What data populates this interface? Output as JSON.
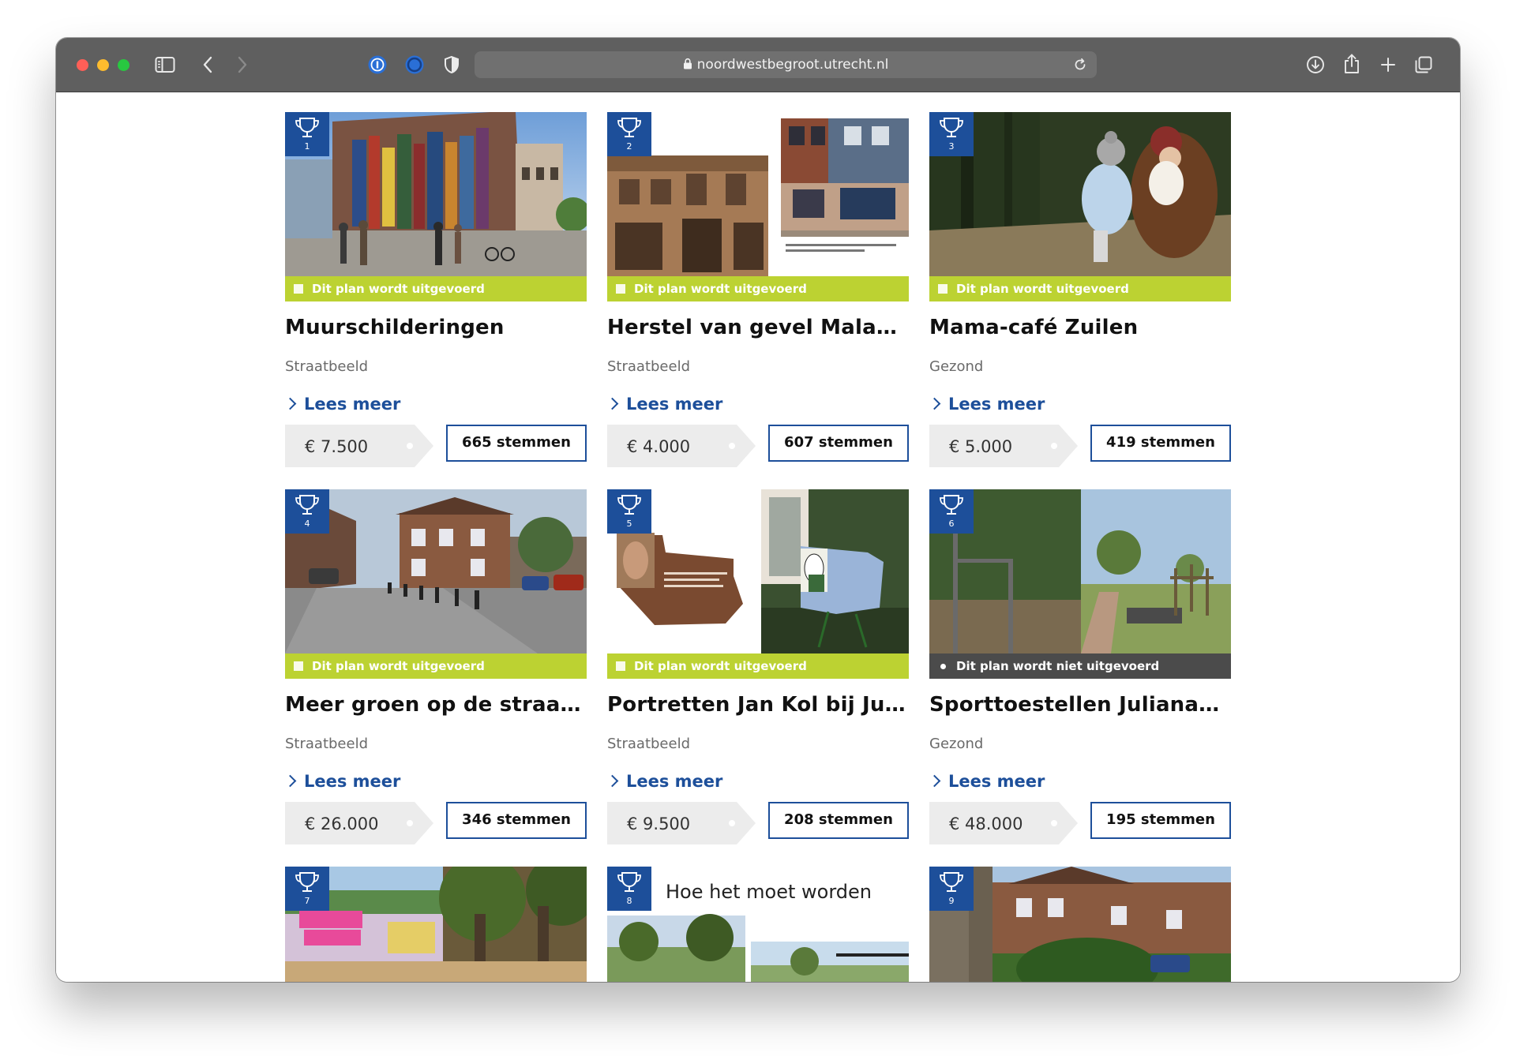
{
  "browser": {
    "url": "noordwestbegroot.utrecht.nl"
  },
  "cards": [
    {
      "rank": "1",
      "status": "Dit plan wordt uitgevoerd",
      "status_type": "executed",
      "title": "Muurschilderingen",
      "category": "Straatbeeld",
      "read_more": "Lees meer",
      "budget": "€ 7.500",
      "votes": "665 stemmen"
    },
    {
      "rank": "2",
      "status": "Dit plan wordt uitgevoerd",
      "status_type": "executed",
      "title": "Herstel van gevel Malabata",
      "category": "Straatbeeld",
      "read_more": "Lees meer",
      "budget": "€ 4.000",
      "votes": "607 stemmen"
    },
    {
      "rank": "3",
      "status": "Dit plan wordt uitgevoerd",
      "status_type": "executed",
      "title": "Mama-café Zuilen",
      "category": "Gezond",
      "read_more": "Lees meer",
      "budget": "€ 5.000",
      "votes": "419 stemmen"
    },
    {
      "rank": "4",
      "status": "Dit plan wordt uitgevoerd",
      "status_type": "executed",
      "title": "Meer groen op de straatho...",
      "category": "Straatbeeld",
      "read_more": "Lees meer",
      "budget": "€ 26.000",
      "votes": "346 stemmen"
    },
    {
      "rank": "5",
      "status": "Dit plan wordt uitgevoerd",
      "status_type": "executed",
      "title": "Portretten Jan Kol bij Julia...",
      "category": "Straatbeeld",
      "read_more": "Lees meer",
      "budget": "€ 9.500",
      "votes": "208 stemmen"
    },
    {
      "rank": "6",
      "status": "Dit plan wordt niet uitgevoerd",
      "status_type": "not_executed",
      "title": "Sporttoestellen Julianapark",
      "category": "Gezond",
      "read_more": "Lees meer",
      "budget": "€ 48.000",
      "votes": "195 stemmen"
    },
    {
      "rank": "7"
    },
    {
      "rank": "8",
      "image_caption": "Hoe het moet worden"
    },
    {
      "rank": "9"
    }
  ],
  "colors": {
    "brand_blue": "#1d4f9a",
    "status_green": "#bcd232",
    "status_dark": "#4b4b4b",
    "price_grey": "#ececec"
  }
}
